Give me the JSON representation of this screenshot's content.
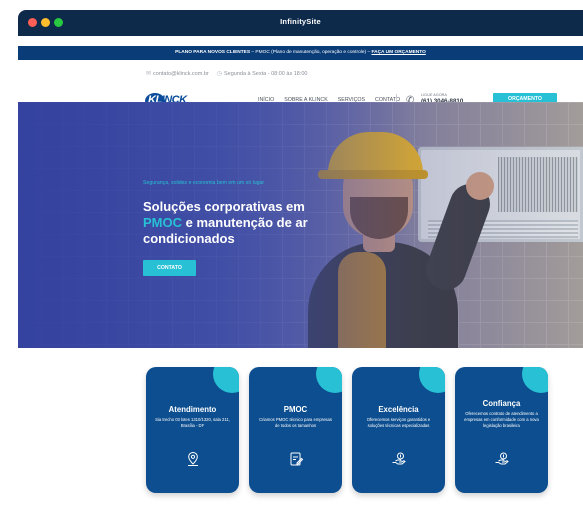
{
  "window": {
    "title": "InfinitySite"
  },
  "promo": {
    "label": "PLANO PARA NOVOS CLIENTES",
    "text": "PMOC (Plano de manutenção, operação e controle)",
    "cta": "FAÇA UM ORÇAMENTO"
  },
  "infobar": {
    "email": "contato@klinck.com.br",
    "hours": "Segunda à Sexta - 08:00 às 18:00"
  },
  "nav": {
    "logo_text_a": "KL",
    "logo_text_b": "INCK",
    "items": [
      "INÍCIO",
      "SOBRE A KLINCK",
      "SERVIÇOS",
      "CONTATO"
    ],
    "phone_label": "LIGUE AGORA",
    "phone_number": "(61) 3046-8810",
    "quote_button": "ORÇAMENTO"
  },
  "hero": {
    "kicker": "Segurança, solidez e economia bem em um só lugar",
    "title_a": "Soluções corporativas em",
    "title_hl": "PMOC",
    "title_b": "e manutenção de ar condicionados",
    "button": "CONTATO"
  },
  "cards": [
    {
      "title": "Atendimento",
      "desc": "Sia trecho 03 lotes 1310/1320, sala 211, Brasília - DF",
      "icon": "map-pin-icon"
    },
    {
      "title": "PMOC",
      "desc": "Criamos PMOC técnico para empresas de todos os tamanhos",
      "icon": "document-edit-icon"
    },
    {
      "title": "Excelência",
      "desc": "Oferecemos serviços garantidos e soluções técnicas especializadas",
      "icon": "hand-coin-icon"
    },
    {
      "title": "Confiança",
      "desc": "Oferecemos contrato de atendimento a empresas em conformidade com a nova legislação brasileira",
      "icon": "hand-coin-icon"
    }
  ],
  "colors": {
    "accent": "#27c0d4",
    "primary": "#0c4e8f",
    "titlebar": "#0e2a4a"
  }
}
